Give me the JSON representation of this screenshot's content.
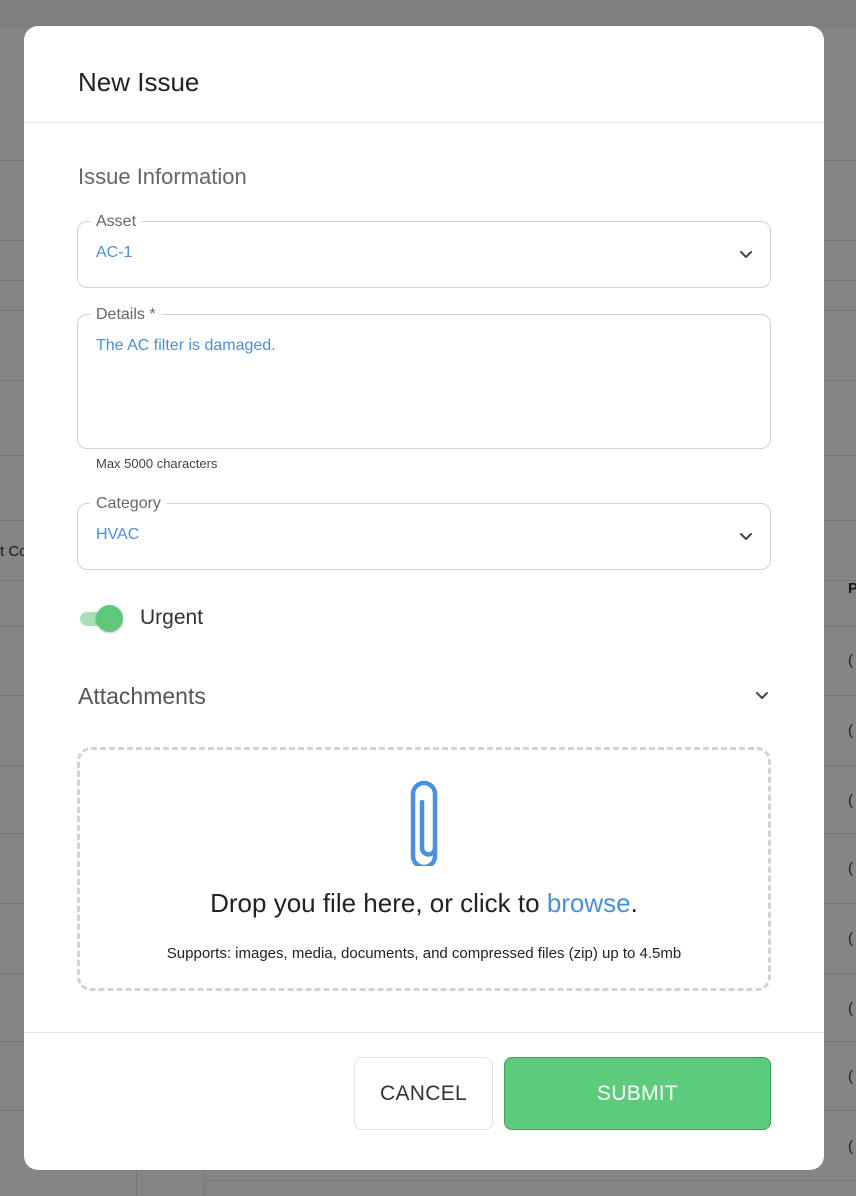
{
  "background": {
    "fragment_1": "t Co",
    "fragment_2": "P",
    "row_markers": [
      "(",
      "(",
      "(",
      "(",
      "(",
      "(",
      "(",
      "("
    ]
  },
  "modal": {
    "title": "New Issue",
    "section_title": "Issue Information",
    "asset": {
      "label": "Asset",
      "value": "AC-1"
    },
    "details": {
      "label": "Details *",
      "value": "The AC filter is damaged.",
      "helper": "Max 5000 characters"
    },
    "category": {
      "label": "Category",
      "value": "HVAC"
    },
    "urgent": {
      "label": "Urgent",
      "checked": true
    },
    "attachments": {
      "title": "Attachments",
      "drop_text": "Drop you file here, or click to ",
      "drop_link": "browse",
      "drop_period": ".",
      "supports": "Supports: images, media, documents, and compressed files (zip) up to 4.5mb"
    },
    "footer": {
      "cancel": "CANCEL",
      "submit": "SUBMIT"
    }
  },
  "colors": {
    "accent": "#4a90d9",
    "success": "#5dcb7c",
    "toggle_on": "#5cc87a"
  },
  "icons": [
    "chevron-down-icon",
    "paperclip-icon"
  ]
}
